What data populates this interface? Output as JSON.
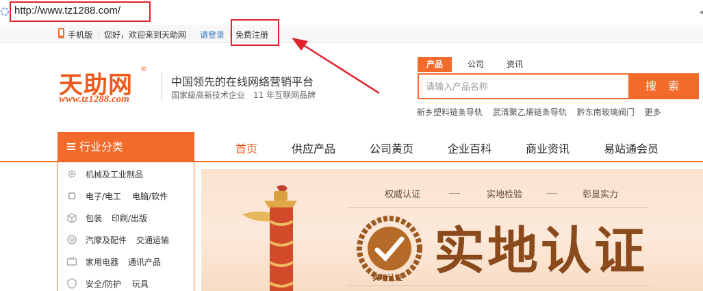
{
  "browser": {
    "url": "http://www.tz1288.com/"
  },
  "topbar": {
    "mobile_label": "手机版",
    "welcome": "您好，欢迎来到天助网",
    "login": "请登录",
    "register": "免费注册"
  },
  "header": {
    "logo_text": "天助网",
    "logo_url": "www.tz1288.com",
    "slogan": "中国领先的在线网络营销平台",
    "subslogan": "国家级高新技术企业　11 年互联网品牌"
  },
  "search": {
    "tabs": [
      "产品",
      "公司",
      "资讯"
    ],
    "active_tab": "产品",
    "placeholder": "请输入产品名称",
    "button": "搜 索",
    "hot_links": [
      "新乡塑料链条导轨",
      "武清聚乙烯链条导轨",
      "黔东南玻璃阀门",
      "更多"
    ]
  },
  "nav": {
    "category_title": "行业分类",
    "items": [
      "首页",
      "供应产品",
      "公司黄页",
      "企业百科",
      "商业资讯",
      "易站通会员"
    ],
    "active": "首页"
  },
  "categories": [
    {
      "icon": "gear-icon",
      "labels": [
        "机械及工业制品"
      ]
    },
    {
      "icon": "chip-icon",
      "labels": [
        "电子/电工",
        "电脑/软件"
      ]
    },
    {
      "icon": "box-icon",
      "labels": [
        "包装",
        "印刷/出版"
      ]
    },
    {
      "icon": "wheel-icon",
      "labels": [
        "汽摩及配件",
        "交通运输"
      ]
    },
    {
      "icon": "tv-icon",
      "labels": [
        "家用电器",
        "通讯产品"
      ]
    },
    {
      "icon": "shield-icon",
      "labels": [
        "安全/防护",
        "玩具"
      ]
    }
  ],
  "banner": {
    "tags": [
      "权威认证",
      "实地检验",
      "彰显实力"
    ],
    "title": "实地认证",
    "seal_text": "实地认证"
  },
  "colors": {
    "brand_orange": "#f26b2a",
    "highlight_red": "#e0202a",
    "link_blue": "#3a78c7"
  }
}
